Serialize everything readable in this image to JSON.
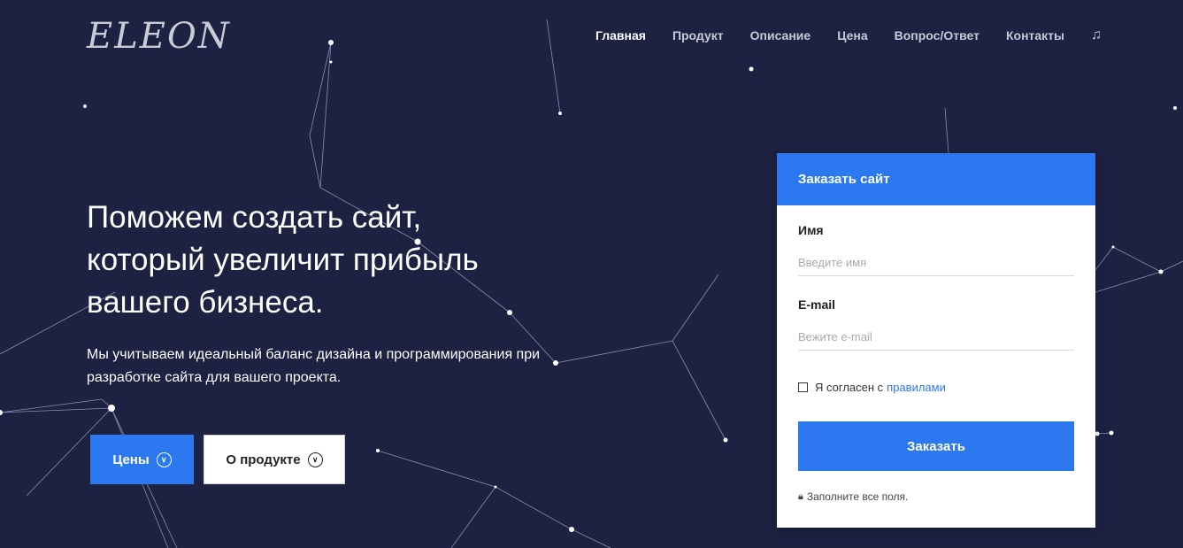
{
  "header": {
    "logo": "ELEON",
    "nav": [
      "Главная",
      "Продукт",
      "Описание",
      "Цена",
      "Вопрос/Ответ",
      "Контакты"
    ],
    "music_icon": "music-note-icon"
  },
  "hero": {
    "title_lines": [
      "Поможем создать сайт,",
      "который увеличит прибыль",
      "вашего бизнеса."
    ],
    "description": "Мы учитываем идеальный баланс дизайна и программирования при разработке сайта для вашего проекта.",
    "primary_button": "Цены",
    "secondary_button": "О продукте"
  },
  "form": {
    "header": "Заказать сайт",
    "name_label": "Имя",
    "name_placeholder": "Введите имя",
    "email_label": "E-mail",
    "email_placeholder": "Вежите e-mail",
    "agree_text": "Я согласен с",
    "agree_link": "правилами",
    "submit": "Заказать",
    "note": "Заполните все поля."
  },
  "colors": {
    "background": "#1d2142",
    "accent": "#2b78f0"
  }
}
